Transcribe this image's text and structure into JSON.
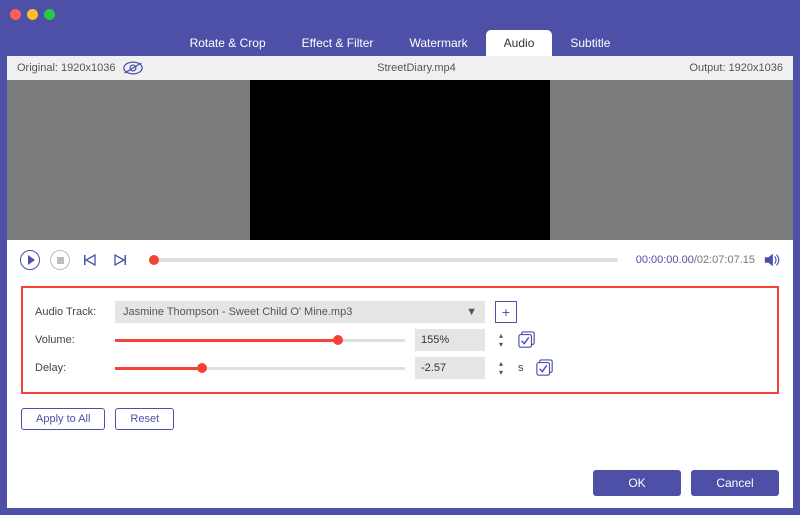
{
  "tabs": {
    "rotate_crop": "Rotate & Crop",
    "effect_filter": "Effect & Filter",
    "watermark": "Watermark",
    "audio": "Audio",
    "subtitle": "Subtitle"
  },
  "info": {
    "original_label": "Original: 1920x1036",
    "filename": "StreetDiary.mp4",
    "output_label": "Output: 1920x1036"
  },
  "playback": {
    "current_time": "00:00:00.00",
    "total_time": "/02:07:07.15"
  },
  "audio_panel": {
    "track_label": "Audio Track:",
    "track_value": "Jasmine Thompson - Sweet Child O' Mine.mp3",
    "volume_label": "Volume:",
    "volume_value": "155%",
    "volume_percent": 77,
    "delay_label": "Delay:",
    "delay_value": "-2.57",
    "delay_percent": 30,
    "delay_unit": "s"
  },
  "buttons": {
    "apply_all": "Apply to All",
    "reset": "Reset",
    "ok": "OK",
    "cancel": "Cancel"
  }
}
